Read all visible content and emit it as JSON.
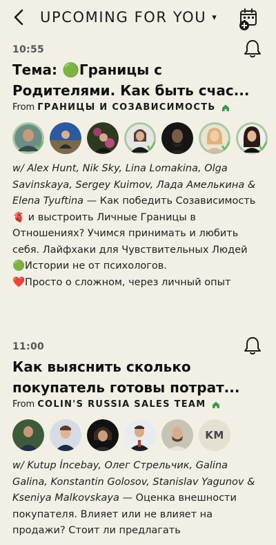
{
  "header": {
    "title": "UPCOMING FOR YOU",
    "caret": "▾"
  },
  "events": [
    {
      "time": "10:55",
      "title_line1": "Тема: 🟢Границы с",
      "title_line2": "Родителями. Как быть счас...",
      "from_prefix": "From",
      "club": "ГРАНИЦЫ И СОЗАВИСИМОСТЬ",
      "avatars": [
        "Alex Hunt",
        "Nik Sky",
        "Lina Lomakina",
        "Olga Savinskaya",
        "Sergey Kuimov",
        "Лада Амелькина",
        "Elena Tyuftina"
      ],
      "speakers": "w/ Alex Hunt, Nik Sky, Lina Lomakina, Olga Savinskaya, Sergey Kuimov, Лада Амелькина & Elena Tyuftina",
      "description": " — Как победить Созависимость 🫀 и выстроить Личные Границы в Отношениях? Учимся принимать и любить себя. Лайфхаки для Чувствительных Людей 🟢Истории не от психологов.",
      "description_line2": "❤️Просто о сложном, через личный опыт"
    },
    {
      "time": "11:00",
      "title_line1": "Как выяснить сколько",
      "title_line2": "покупатель готовы потрат...",
      "from_prefix": "From",
      "club": "COLIN'S RUSSIA SALES TEAM",
      "avatars": [
        "Kutup İncebay",
        "Олег Стрельчик",
        "Galina Galina",
        "Konstantin Golosov",
        "Stanislav Yagunov",
        "KM"
      ],
      "avatar_initials": "KM",
      "speakers": "w/ Kutup İncebay, Олег Стрельчик, Galina Galina, Konstantin Golosov, Stanislav Yagunov & Kseniya Malkovskaya",
      "description": " — Оценка внешности покупателя. Влияет или не влияет на продажи? Стоит ли предлагать"
    }
  ],
  "colors": {
    "background": "#f2efe4",
    "accent_green": "#3b9b4a",
    "text": "#1a1a1a"
  },
  "icons": [
    "back-arrow-icon",
    "caret-down-icon",
    "calendar-add-icon",
    "bell-icon",
    "house-icon"
  ]
}
